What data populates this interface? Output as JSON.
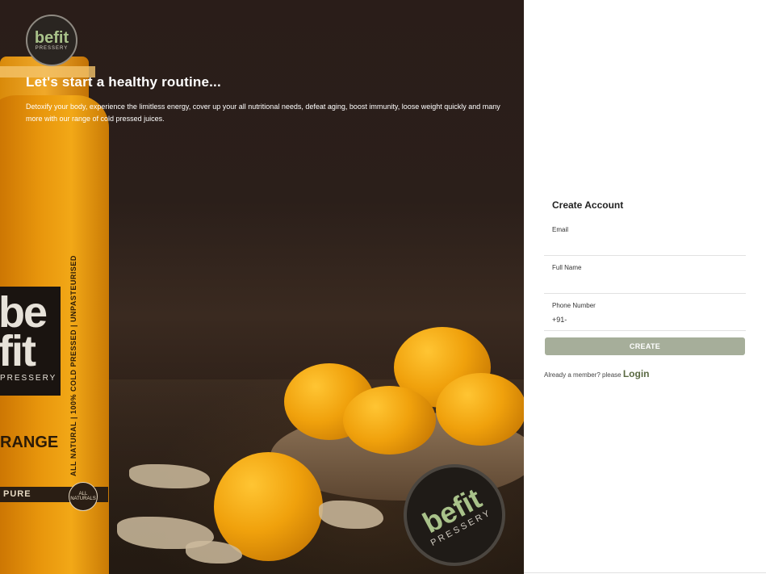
{
  "brand": {
    "logo_text": "befit",
    "logo_subtext": "PRESSERY"
  },
  "hero": {
    "title": "Let's start a healthy routine...",
    "description": "Detoxify your body, experience the limitless energy, cover up your all nutritional needs, defeat aging, boost immunity, loose weight quickly and many more with our range of cold pressed juices."
  },
  "bottle_label": {
    "be": "be",
    "fit": "fit",
    "pressery": "PRESSERY",
    "flavor": "RANGE",
    "vertical": "ALL NATURAL | 100% COLD PRESSED | UNPASTEURISED",
    "pure": "PURE",
    "badge": "ALL NATURALS"
  },
  "form": {
    "title": "Create Account",
    "fields": [
      {
        "label": "Email",
        "value": "",
        "placeholder": ""
      },
      {
        "label": "Full Name",
        "value": "",
        "placeholder": ""
      },
      {
        "label": "Phone Number",
        "value": "+91-",
        "placeholder": ""
      }
    ],
    "submit_label": "CREATE",
    "login_prompt": "Already a member? please",
    "login_label": "Login"
  },
  "colors": {
    "button": "#a6ae9a",
    "login_link": "#5b6a43",
    "logo_green": "#a9c28a"
  }
}
